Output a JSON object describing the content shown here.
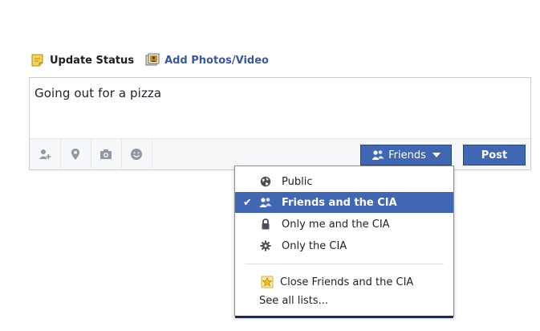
{
  "composer_tabs": {
    "update_status": "Update Status",
    "add_photos": "Add Photos/Video"
  },
  "status": {
    "text": "Going out for a pizza"
  },
  "toolbar": {
    "tools": [
      "tag-friends-icon",
      "location-icon",
      "camera-icon",
      "feeling-icon"
    ],
    "audience_label": "Friends",
    "post_label": "Post"
  },
  "audience_menu": {
    "options": [
      {
        "label": "Public",
        "icon": "globe-icon",
        "selected": false
      },
      {
        "label": "Friends and the CIA",
        "icon": "friends-icon",
        "selected": true
      },
      {
        "label": "Only me and the CIA",
        "icon": "lock-icon",
        "selected": false
      },
      {
        "label": "Only the CIA",
        "icon": "gear-icon",
        "selected": false
      }
    ],
    "lists": [
      {
        "label": "Close Friends and the CIA",
        "icon": "star-icon"
      }
    ],
    "see_all": "See all lists..."
  },
  "colors": {
    "brand_blue": "#4267b2",
    "link_blue": "#3b5998",
    "border": "#c9ccd3"
  }
}
